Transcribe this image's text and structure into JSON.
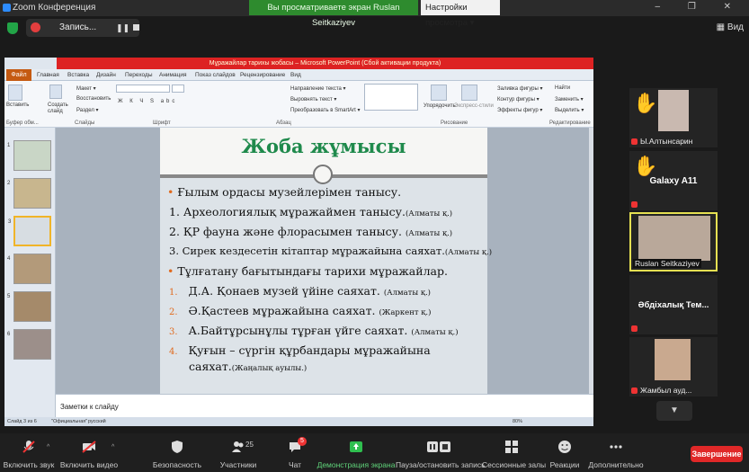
{
  "window": {
    "title": "Zoom Конференция",
    "controls": "‒ ❐ ✕"
  },
  "banner": {
    "sharing_text": "Вы просматриваете экран Ruslan Seitkaziyev",
    "view_options": "Настройки просмотра ▾"
  },
  "record": {
    "label": "Запись...",
    "pause_glyph": "❚❚"
  },
  "gallery_view": "Вид",
  "ppt": {
    "title": "Мұражайлар тарихы жобасы  –  Microsoft PowerPoint (Сбой активации продукта)",
    "file_tab": "Файл",
    "tabs": [
      "Главная",
      "Вставка",
      "Дизайн",
      "Переходы",
      "Анимация",
      "Показ слайдов",
      "Рецензирование",
      "Вид"
    ],
    "ribbon": {
      "paste": "Вставить",
      "clipboard": "Буфер обм...",
      "new_slide": "Создать слайд",
      "slides_group": "Слайды",
      "layout": "Макет ▾",
      "reset": "Восстановить",
      "section": "Раздел ▾",
      "font_group": "Шрифт",
      "paragraph_group": "Абзац",
      "text_direction": "Направление текста ▾",
      "align_text": "Выровнять текст ▾",
      "smartart": "Преобразовать в SmartArt ▾",
      "arrange": "Упорядочить",
      "quick_styles": "Экспресс-стили",
      "shape_fill": "Заливка фигуры ▾",
      "shape_outline": "Контур фигуры ▾",
      "shape_effects": "Эффекты фигур ▾",
      "drawing_group": "Рисование",
      "find": "Найти",
      "replace": "Заменить ▾",
      "select": "Выделить ▾",
      "editing_group": "Редактирование"
    },
    "slide": {
      "title": "Жоба жұмысы",
      "lines": [
        {
          "marker": "•",
          "text": "Ғылым ордасы музейлерімен танысу.",
          "note": ""
        },
        {
          "marker": "",
          "text": "1. Археологиялық мұражаймен танысу.",
          "note": "(Алматы қ.)"
        },
        {
          "marker": "",
          "text": "2. ҚР фауна және флорасымен танысу.",
          "note": "(Алматы қ.)"
        },
        {
          "marker": "",
          "text": "3. Сирек кездесетін кітаптар мұражайына саяхат.",
          "note": "(Алматы қ.)"
        },
        {
          "marker": "•",
          "text": "Тұлғатану бағытындағы тарихи мұражайлар.",
          "note": ""
        },
        {
          "marker": "1.",
          "text": "Д.А. Қонаев музей үйіне саяхат.",
          "note": "(Алматы қ.)"
        },
        {
          "marker": "2.",
          "text": "Ә.Қастеев мұражайына саяхат.",
          "note": "(Жаркент қ.)"
        },
        {
          "marker": "3.",
          "text": "А.Байтұрсынұлы тұрған үйге саяхат.",
          "note": "(Алматы қ.)"
        },
        {
          "marker": "4.",
          "text": "Қуғын – сүргін құрбандары мұражайына",
          "note": ""
        },
        {
          "marker": "",
          "text": "саяхат.",
          "note": "(Жаңалық ауылы.)"
        }
      ]
    },
    "thumb_numbers": [
      "1",
      "2",
      "3",
      "4",
      "5",
      "6"
    ],
    "notes_placeholder": "Заметки к слайду",
    "status": {
      "slide": "Слайд 3 из 6",
      "theme": "\"Официальная\"",
      "lang": "русский",
      "zoom": "80%"
    }
  },
  "participants": [
    {
      "name": "Ы.Алтынсарин",
      "hand": true
    },
    {
      "name": "Galaxy A11",
      "hand": true
    },
    {
      "name": "Ruslan Seitkaziyev",
      "hand": false
    },
    {
      "name": "Әбдіхалық Тем...",
      "hand": false
    },
    {
      "name": "Жамбыл ауд...",
      "hand": false
    }
  ],
  "toolbar": {
    "audio": "Включить звук",
    "video": "Включить видео",
    "security": "Безопасность",
    "participants": "Участники",
    "participants_count": "25",
    "chat": "Чат",
    "chat_badge": "5",
    "share": "Демонстрация экрана",
    "pause_record": "Пауза/остановить запись",
    "breakout": "Сессионные залы",
    "reactions": "Реакции",
    "more": "Дополнительно",
    "end": "Завершение"
  },
  "colors": {
    "zoom_green": "#2e8b2e",
    "end_red": "#e02828",
    "slide_title_green": "#1f8a4c",
    "ppt_title_red": "#dd2222"
  }
}
